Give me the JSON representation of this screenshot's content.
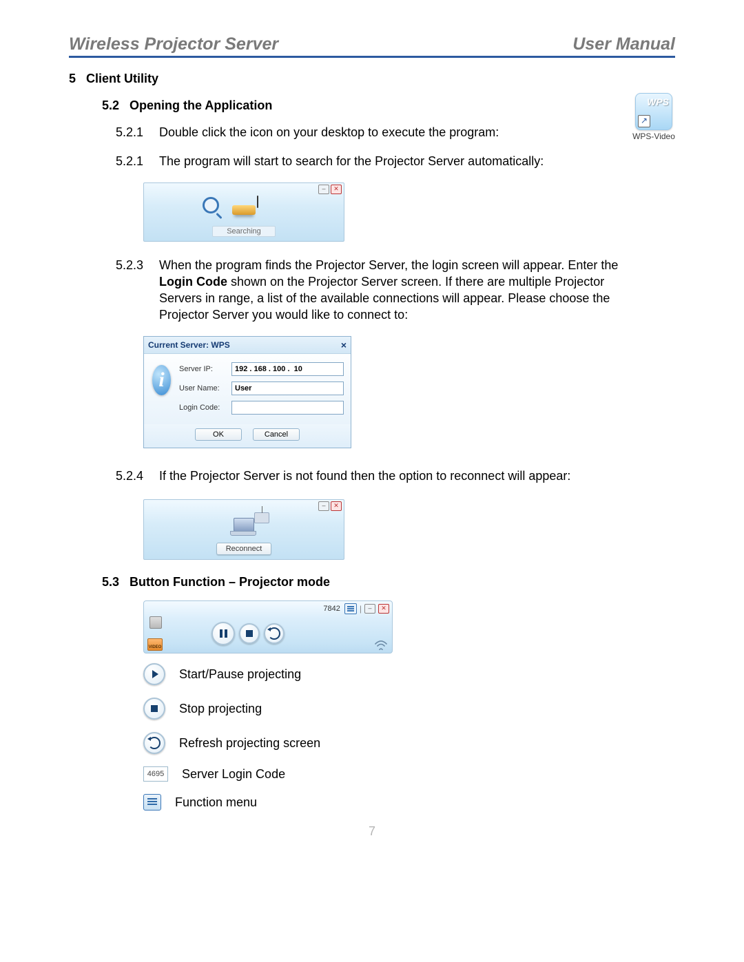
{
  "header": {
    "left": "Wireless Projector Server",
    "right": "User Manual"
  },
  "section": {
    "num": "5",
    "title": "Client Utility"
  },
  "sub_52": {
    "num": "5.2",
    "title": "Opening the Application"
  },
  "sub_53": {
    "num": "5.3",
    "title": "Button Function – Projector mode"
  },
  "steps": {
    "s521": {
      "num": "5.2.1",
      "text": "Double click the icon on your desktop to execute the program:"
    },
    "s521b": {
      "num": "5.2.1",
      "text": "The program will start to search for the Projector Server automatically:"
    },
    "s523": {
      "num": "5.2.3",
      "text_before": "When the program finds the Projector Server, the login screen will appear. Enter the ",
      "bold": "Login Code",
      "text_after": " shown on the Projector Server screen. If there are multiple Projector Servers in range, a list of the available connections will appear. Please choose the Projector Server you would like to connect to:"
    },
    "s524": {
      "num": "5.2.4",
      "text": "If the Projector Server is not found then the option to reconnect will appear:"
    }
  },
  "desktop_icon": {
    "wps": "WPS",
    "label": "WPS-Video",
    "arrow": "↗"
  },
  "search_win": {
    "status": "Searching"
  },
  "login_win": {
    "title": "Current Server: WPS",
    "labels": {
      "ip": "Server IP:",
      "user": "User Name:",
      "code": "Login Code:"
    },
    "values": {
      "ip": "192 . 168 . 100 .  10",
      "user": "User",
      "code": ""
    },
    "buttons": {
      "ok": "OK",
      "cancel": "Cancel"
    }
  },
  "reconnect_win": {
    "button": "Reconnect"
  },
  "proj_win": {
    "code": "7842",
    "video_tab": "VIDEO"
  },
  "legend": {
    "play": "Start/Pause projecting",
    "stop": "Stop projecting",
    "refresh": "Refresh projecting screen",
    "code": "Server Login Code",
    "code_value": "4695",
    "menu": "Function menu"
  },
  "page_number": "7"
}
